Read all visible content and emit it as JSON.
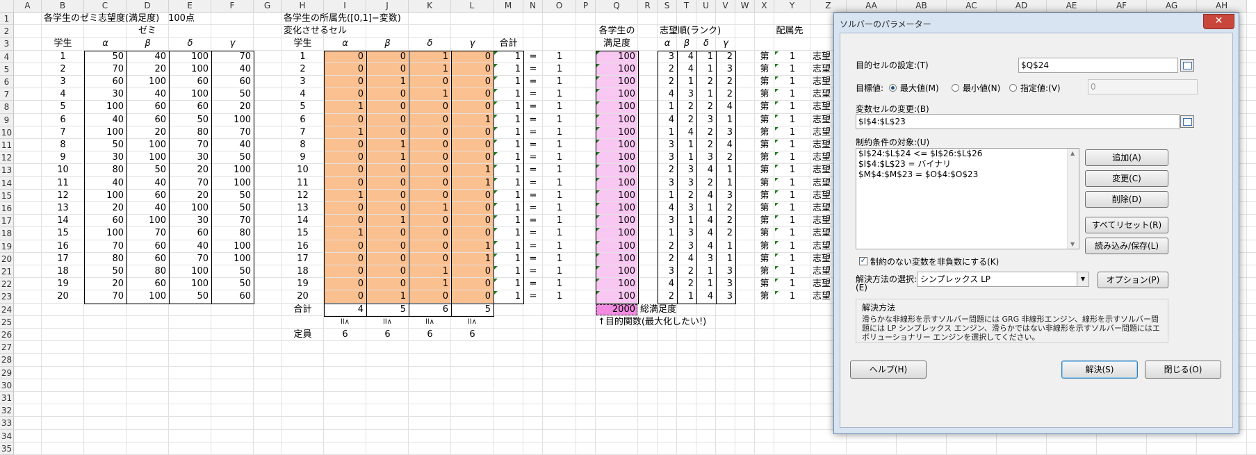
{
  "columns": [
    "A",
    "B",
    "C",
    "D",
    "E",
    "F",
    "G",
    "H",
    "I",
    "J",
    "K",
    "L",
    "M",
    "N",
    "O",
    "P",
    "Q",
    "R",
    "S",
    "T",
    "U",
    "V",
    "W",
    "X",
    "Y",
    "Z",
    "AA",
    "AB",
    "AC",
    "AD",
    "AE",
    "AF",
    "AG",
    "AH"
  ],
  "rows": [
    "1",
    "2",
    "3",
    "4",
    "5",
    "6",
    "7",
    "8",
    "9",
    "10",
    "11",
    "12",
    "13",
    "14",
    "15",
    "16",
    "17",
    "18",
    "19",
    "20",
    "21",
    "22",
    "23",
    "24",
    "25",
    "26",
    "27",
    "28",
    "29",
    "30",
    "31",
    "32",
    "33",
    "34",
    "35"
  ],
  "sheet": {
    "title_left": "各学生のゼミ志望度(満足度)　100点",
    "zemi_label": "ゼミ",
    "student_header": "学生",
    "greek": [
      "α",
      "β",
      "δ",
      "γ"
    ],
    "students": [
      "1",
      "2",
      "3",
      "4",
      "5",
      "6",
      "7",
      "8",
      "9",
      "10",
      "11",
      "12",
      "13",
      "14",
      "15",
      "16",
      "17",
      "18",
      "19",
      "20"
    ],
    "preference": [
      [
        "50",
        "40",
        "100",
        "70"
      ],
      [
        "70",
        "20",
        "100",
        "40"
      ],
      [
        "60",
        "100",
        "60",
        "60"
      ],
      [
        "30",
        "40",
        "100",
        "50"
      ],
      [
        "100",
        "60",
        "60",
        "20"
      ],
      [
        "40",
        "60",
        "50",
        "100"
      ],
      [
        "100",
        "20",
        "80",
        "70"
      ],
      [
        "50",
        "100",
        "70",
        "40"
      ],
      [
        "30",
        "100",
        "30",
        "50"
      ],
      [
        "80",
        "50",
        "20",
        "100"
      ],
      [
        "40",
        "40",
        "70",
        "100"
      ],
      [
        "100",
        "60",
        "20",
        "50"
      ],
      [
        "20",
        "40",
        "100",
        "50"
      ],
      [
        "60",
        "100",
        "30",
        "70"
      ],
      [
        "100",
        "70",
        "60",
        "80"
      ],
      [
        "70",
        "60",
        "40",
        "100"
      ],
      [
        "80",
        "60",
        "70",
        "100"
      ],
      [
        "50",
        "80",
        "100",
        "50"
      ],
      [
        "20",
        "60",
        "100",
        "50"
      ],
      [
        "70",
        "100",
        "50",
        "60"
      ]
    ],
    "title_mid": "各学生の所属先([0,1]−変数)",
    "change_cells": "変化させるセル",
    "sum_header": "合計",
    "assign": [
      [
        "0",
        "0",
        "1",
        "0"
      ],
      [
        "0",
        "0",
        "1",
        "0"
      ],
      [
        "0",
        "1",
        "0",
        "0"
      ],
      [
        "0",
        "0",
        "1",
        "0"
      ],
      [
        "1",
        "0",
        "0",
        "0"
      ],
      [
        "0",
        "0",
        "0",
        "1"
      ],
      [
        "1",
        "0",
        "0",
        "0"
      ],
      [
        "0",
        "1",
        "0",
        "0"
      ],
      [
        "0",
        "1",
        "0",
        "0"
      ],
      [
        "0",
        "0",
        "0",
        "1"
      ],
      [
        "0",
        "0",
        "0",
        "1"
      ],
      [
        "1",
        "0",
        "0",
        "0"
      ],
      [
        "0",
        "0",
        "1",
        "0"
      ],
      [
        "0",
        "1",
        "0",
        "0"
      ],
      [
        "1",
        "0",
        "0",
        "0"
      ],
      [
        "0",
        "0",
        "0",
        "1"
      ],
      [
        "0",
        "0",
        "0",
        "1"
      ],
      [
        "0",
        "0",
        "1",
        "0"
      ],
      [
        "0",
        "0",
        "1",
        "0"
      ],
      [
        "0",
        "1",
        "0",
        "0"
      ]
    ],
    "row_sum": "1",
    "eq": "=",
    "row_target": "1",
    "total_label": "合計",
    "col_totals": [
      "4",
      "5",
      "6",
      "5"
    ],
    "geq": "ll∧",
    "capacity_label": "定員",
    "capacity": [
      "6",
      "6",
      "6",
      "6"
    ],
    "sat_header1": "各学生の",
    "sat_header2": "満足度",
    "satisfaction": "100",
    "total_sat": "2000",
    "total_sat_label": "総満足度",
    "objective_note": "↑目的関数(最大化したい!)",
    "rank_header": "志望順(ランク)",
    "ranks": [
      [
        "3",
        "4",
        "1",
        "2"
      ],
      [
        "2",
        "4",
        "1",
        "3"
      ],
      [
        "2",
        "1",
        "2",
        "2"
      ],
      [
        "4",
        "3",
        "1",
        "2"
      ],
      [
        "1",
        "2",
        "2",
        "4"
      ],
      [
        "4",
        "2",
        "3",
        "1"
      ],
      [
        "1",
        "4",
        "2",
        "3"
      ],
      [
        "3",
        "1",
        "2",
        "4"
      ],
      [
        "3",
        "1",
        "3",
        "2"
      ],
      [
        "2",
        "3",
        "4",
        "1"
      ],
      [
        "3",
        "3",
        "2",
        "1"
      ],
      [
        "1",
        "2",
        "4",
        "3"
      ],
      [
        "4",
        "3",
        "1",
        "2"
      ],
      [
        "3",
        "1",
        "4",
        "2"
      ],
      [
        "1",
        "3",
        "4",
        "2"
      ],
      [
        "2",
        "3",
        "4",
        "1"
      ],
      [
        "2",
        "4",
        "3",
        "1"
      ],
      [
        "3",
        "2",
        "1",
        "3"
      ],
      [
        "4",
        "2",
        "1",
        "3"
      ],
      [
        "2",
        "1",
        "4",
        "3"
      ]
    ],
    "assign_header": "配属先",
    "dai": "第",
    "assigned_rank": "1",
    "shibou": "志望"
  },
  "dialog": {
    "title": "ソルバーのパラメーター",
    "close": "✕",
    "objective_label": "目的セルの設定:(T)",
    "objective_value": "$Q$24",
    "target_label": "目標値:",
    "opt_max": "最大値(M)",
    "opt_min": "最小値(N)",
    "opt_value": "指定値:(V)",
    "value_field": "0",
    "var_label": "変数セルの変更:(B)",
    "var_value": "$I$4:$L$23",
    "constraints_label": "制約条件の対象:(U)",
    "constraints": [
      "$I$24:$L$24 <= $I$26:$L$26",
      "$I$4:$L$23 = バイナリ",
      "$M$4:$M$23 = $O$4:$O$23"
    ],
    "btn_add": "追加(A)",
    "btn_change": "変更(C)",
    "btn_delete": "削除(D)",
    "btn_reset": "すべてリセット(R)",
    "btn_load": "読み込み/保存(L)",
    "nonneg_label": "制約のない変数を非負数にする(K)",
    "nonneg_checked": true,
    "method_label1": "解決方法の選択:",
    "method_label2": "(E)",
    "method_value": "シンプレックス LP",
    "btn_options": "オプション(P)",
    "method_group_title": "解決方法",
    "method_desc": "滑らかな非線形を示すソルバー問題には GRG 非線形エンジン、線形を示すソルバー問題には LP シンプレックス エンジン、滑らかではない非線形を示すソルバー問題にはエボリューショナリー エンジンを選択してください。",
    "btn_help": "ヘルプ(H)",
    "btn_solve": "解決(S)",
    "btn_close": "閉じる(O)"
  }
}
